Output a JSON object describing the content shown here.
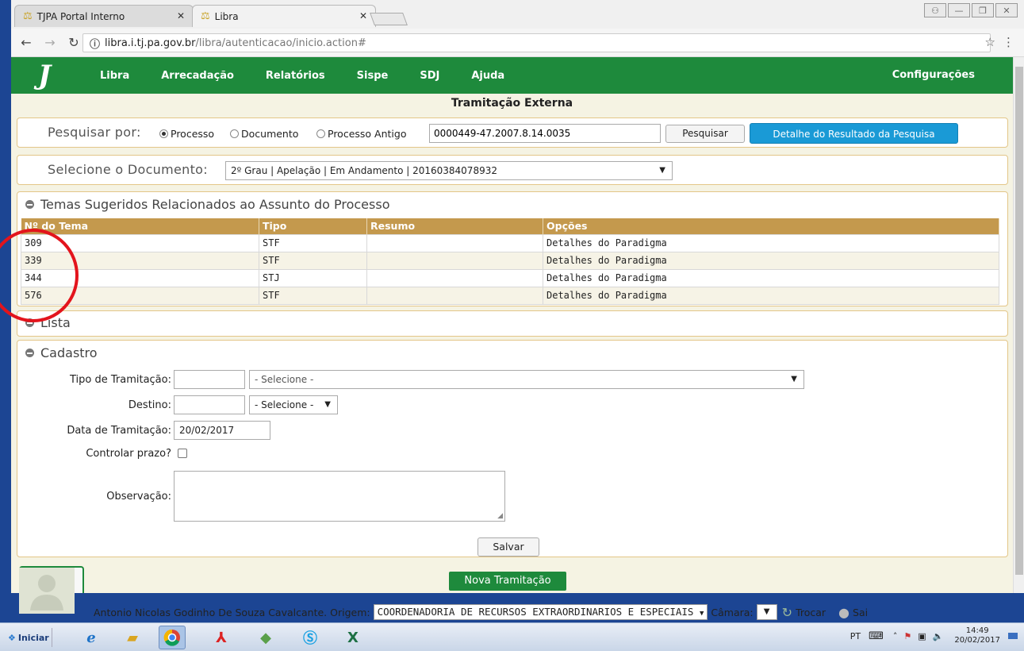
{
  "browser": {
    "tabs": [
      {
        "title": "TJPA  Portal Interno",
        "active": false
      },
      {
        "title": "Libra",
        "active": true
      }
    ],
    "url_host": "libra.i.tj.pa.gov.br",
    "url_path": "/libra/autenticacao/inicio.action#"
  },
  "nav": {
    "logo": "J",
    "items": [
      "Libra",
      "Arrecadação",
      "Relatórios",
      "Sispe",
      "SDJ",
      "Ajuda"
    ],
    "config": "Configurações"
  },
  "page_title": "Tramitação Externa",
  "search": {
    "label": "Pesquisar por:",
    "options": [
      "Processo",
      "Documento",
      "Processo Antigo"
    ],
    "selected": "Processo",
    "value": "0000449-47.2007.8.14.0035",
    "search_button": "Pesquisar",
    "detail_button": "Detalhe do Resultado da Pesquisa"
  },
  "document": {
    "label": "Selecione o Documento:",
    "selected": "2º Grau | Apelação | Em Andamento | 20160384078932"
  },
  "temas": {
    "title": "Temas Sugeridos Relacionados ao Assunto do Processo",
    "columns": [
      "Nº do Tema",
      "Tipo",
      "Resumo",
      "Opções"
    ],
    "rows": [
      {
        "numero": "309",
        "tipo": "STF",
        "resumo": "",
        "opcoes": "Detalhes do Paradigma"
      },
      {
        "numero": "339",
        "tipo": "STF",
        "resumo": "",
        "opcoes": "Detalhes do Paradigma"
      },
      {
        "numero": "344",
        "tipo": "STJ",
        "resumo": "",
        "opcoes": "Detalhes do Paradigma"
      },
      {
        "numero": "576",
        "tipo": "STF",
        "resumo": "",
        "opcoes": "Detalhes do Paradigma"
      }
    ]
  },
  "lista": {
    "title": "Lista"
  },
  "cadastro": {
    "title": "Cadastro",
    "tipo_label": "Tipo de Tramitação:",
    "tipo_select": "- Selecione -",
    "destino_label": "Destino:",
    "destino_select": "- Selecione -",
    "data_label": "Data de Tramitação:",
    "data_value": "20/02/2017",
    "prazo_label": "Controlar prazo?",
    "obs_label": "Observação:",
    "save_button": "Salvar"
  },
  "nova_button": "Nova Tramitação",
  "user": {
    "name": "Antonio Nicolas Godinho De Souza Cavalcante.",
    "origem_label": "Origem:",
    "origem_value": "COORDENADORIA DE RECURSOS EXTRAORDINARIOS E ESPECIAIS",
    "camara_label": "Câmara:",
    "trocar": "Trocar",
    "sair": "Sai"
  },
  "taskbar": {
    "start": "Iniciar",
    "lang": "PT",
    "time": "14:49",
    "date": "20/02/2017"
  },
  "colors": {
    "nav_green": "#1e8a3c",
    "table_header": "#c4994d",
    "detail_button": "#1a9ad6",
    "page_bg": "#f5f3e3",
    "annotation_circle": "#e3141c"
  }
}
